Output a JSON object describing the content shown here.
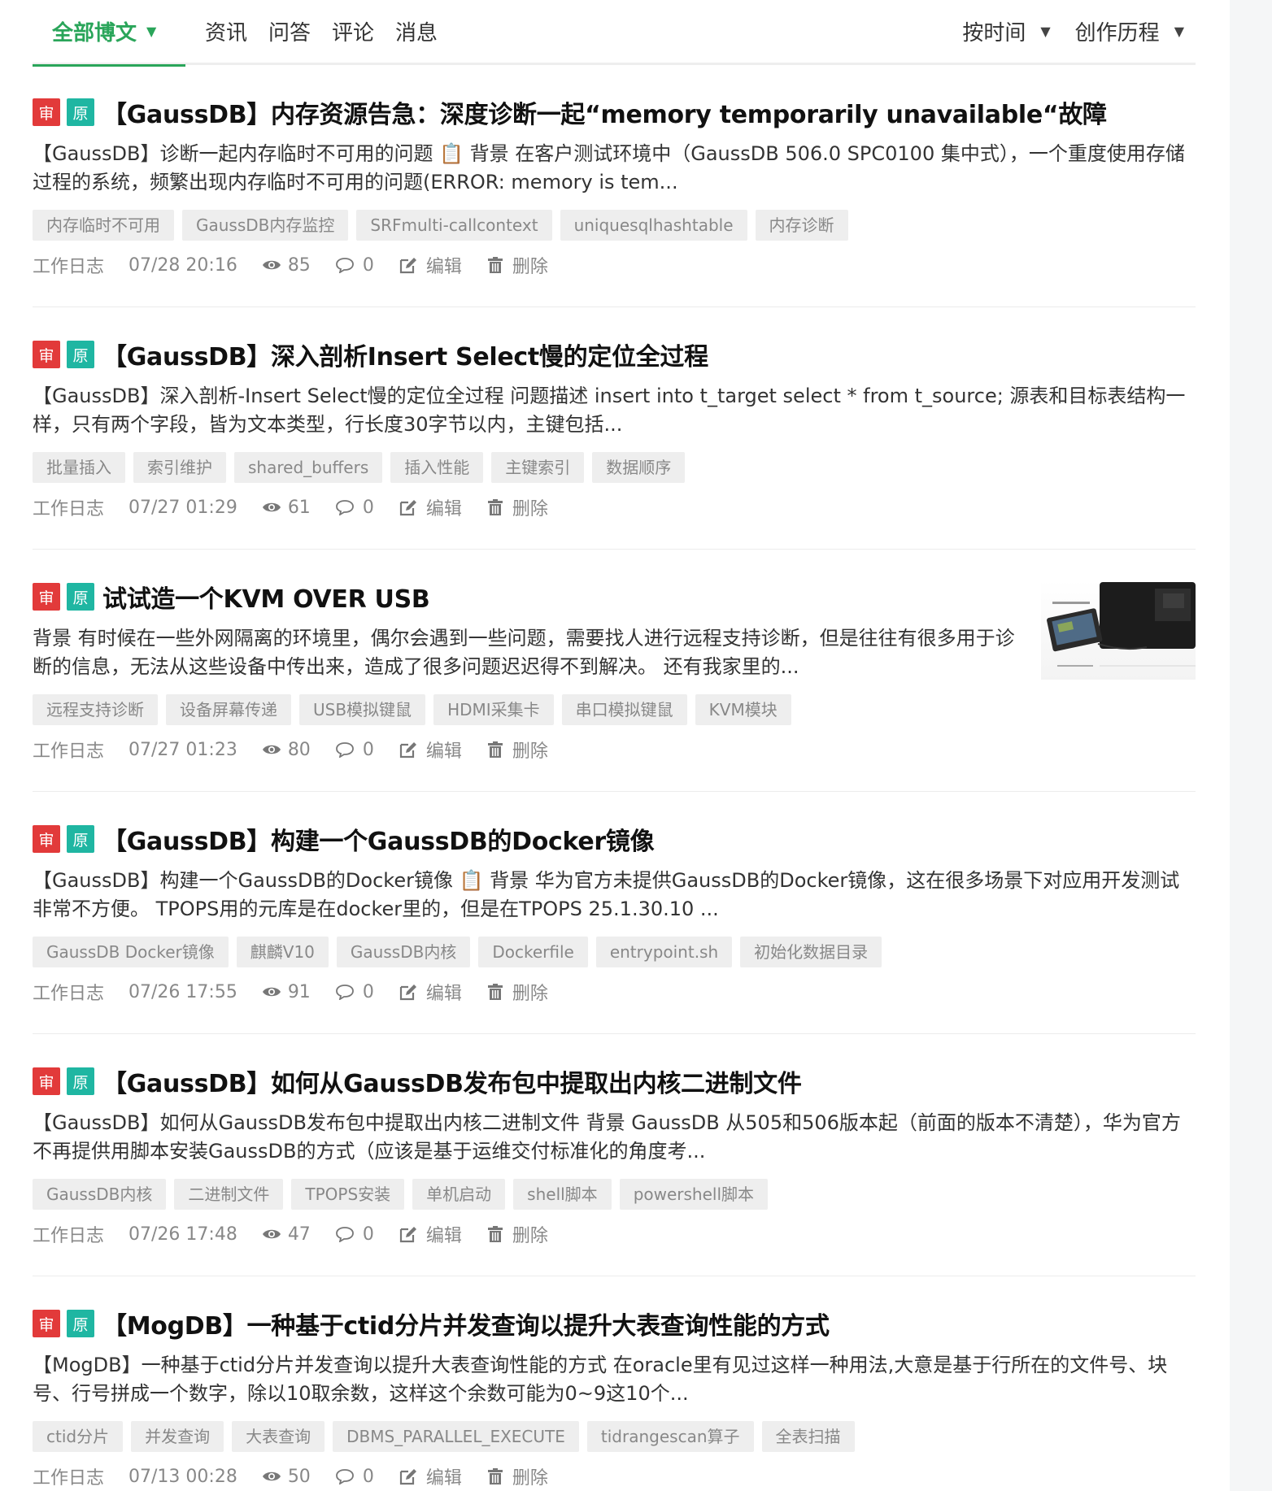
{
  "nav": {
    "tabs": [
      {
        "label": "全部博文",
        "active": true
      },
      {
        "label": "资讯"
      },
      {
        "label": "问答"
      },
      {
        "label": "评论"
      },
      {
        "label": "消息"
      }
    ],
    "sort_label": "按时间",
    "history_label": "创作历程"
  },
  "badges": {
    "audit": "审",
    "original": "原"
  },
  "action_labels": {
    "edit": "编辑",
    "delete": "删除"
  },
  "articles": [
    {
      "title": "【GaussDB】内存资源告急：深度诊断一起“memory temporarily unavailable“故障",
      "summary": "【GaussDB】诊断一起内存临时不可用的问题 📋 背景 在客户测试环境中（GaussDB 506.0 SPC0100 集中式），一个重度使用存储过程的系统，频繁出现内存临时不可用的问题(ERROR: memory is tem...",
      "tags": [
        "内存临时不可用",
        "GaussDB内存监控",
        "SRFmulti-callcontext",
        "uniquesqlhashtable",
        "内存诊断"
      ],
      "category": "工作日志",
      "date": "07/28 20:16",
      "views": "85",
      "comments": "0"
    },
    {
      "title": "【GaussDB】深入剖析Insert Select慢的定位全过程",
      "summary": "【GaussDB】深入剖析-Insert Select慢的定位全过程 问题描述 insert into t_target select * from t_source; 源表和目标表结构一样，只有两个字段，皆为文本类型，行长度30字节以内，主键包括...",
      "tags": [
        "批量插入",
        "索引维护",
        "shared_buffers",
        "插入性能",
        "主键索引",
        "数据顺序"
      ],
      "category": "工作日志",
      "date": "07/27 01:29",
      "views": "61",
      "comments": "0"
    },
    {
      "title": "试试造一个KVM OVER USB",
      "summary": "背景 有时候在一些外网隔离的环境里，偶尔会遇到一些问题，需要找人进行远程支持诊断，但是往往有很多用于诊断的信息，无法从这些设备中传出来，造成了很多问题迟迟得不到解决。 还有我家里的...",
      "tags": [
        "远程支持诊断",
        "设备屏幕传递",
        "USB模拟键鼠",
        "HDMI采集卡",
        "串口模拟键鼠",
        "KVM模块"
      ],
      "category": "工作日志",
      "date": "07/27 01:23",
      "views": "80",
      "comments": "0",
      "thumbnail": true
    },
    {
      "title": "【GaussDB】构建一个GaussDB的Docker镜像",
      "summary": "【GaussDB】构建一个GaussDB的Docker镜像 📋 背景 华为官方未提供GaussDB的Docker镜像，这在很多场景下对应用开发测试非常不方便。 TPOPS用的元库是在docker里的，但是在TPOPS 25.1.30.10 ...",
      "tags": [
        "GaussDB Docker镜像",
        "麒麟V10",
        "GaussDB内核",
        "Dockerfile",
        "entrypoint.sh",
        "初始化数据目录"
      ],
      "category": "工作日志",
      "date": "07/26 17:55",
      "views": "91",
      "comments": "0"
    },
    {
      "title": "【GaussDB】如何从GaussDB发布包中提取出内核二进制文件",
      "summary": "【GaussDB】如何从GaussDB发布包中提取出内核二进制文件 背景 GaussDB 从505和506版本起（前面的版本不清楚），华为官方不再提供用脚本安装GaussDB的方式（应该是基于运维交付标准化的角度考...",
      "tags": [
        "GaussDB内核",
        "二进制文件",
        "TPOPS安装",
        "单机启动",
        "shell脚本",
        "powershell脚本"
      ],
      "category": "工作日志",
      "date": "07/26 17:48",
      "views": "47",
      "comments": "0"
    },
    {
      "title": "【MogDB】一种基于ctid分片并发查询以提升大表查询性能的方式",
      "summary": "【MogDB】一种基于ctid分片并发查询以提升大表查询性能的方式 在oracle里有见过这样一种用法,大意是基于行所在的文件号、块号、行号拼成一个数字，除以10取余数，这样这个余数可能为0~9这10个...",
      "tags": [
        "ctid分片",
        "并发查询",
        "大表查询",
        "DBMS_PARALLEL_EXECUTE",
        "tidrangescan算子",
        "全表扫描"
      ],
      "category": "工作日志",
      "date": "07/13 00:28",
      "views": "50",
      "comments": "0"
    }
  ]
}
